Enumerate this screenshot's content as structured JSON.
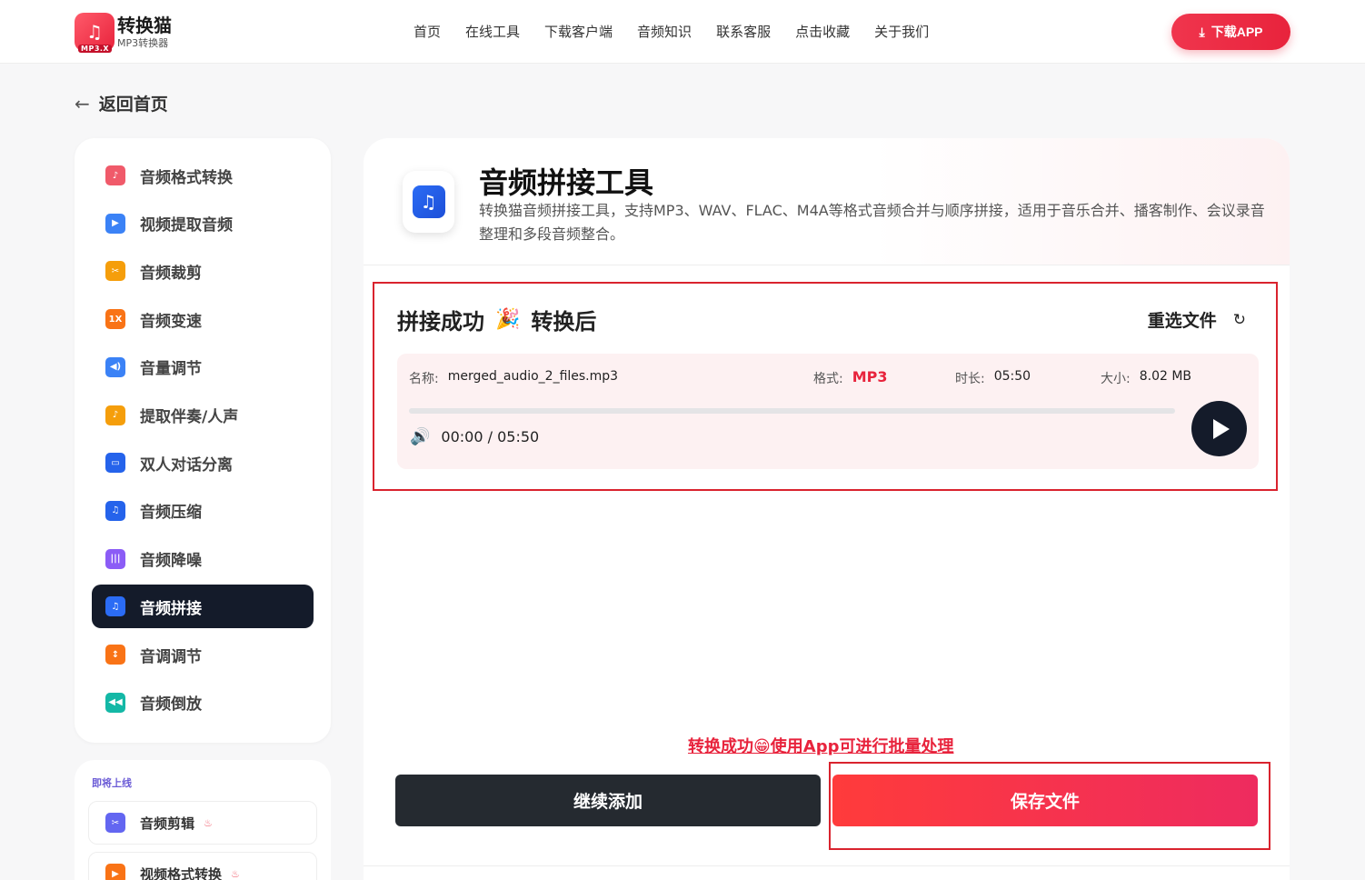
{
  "header": {
    "logo_title": "转换猫",
    "logo_sub": "MP3转换器",
    "logo_badge": "MP3.X",
    "nav": [
      "首页",
      "在线工具",
      "下载客户端",
      "音频知识",
      "联系客服",
      "点击收藏",
      "关于我们"
    ],
    "download_label": "下载APP"
  },
  "back_label": "返回首页",
  "sidebar": {
    "items": [
      {
        "label": "音频格式转换",
        "icon": "audio-format-icon",
        "color": "#f05a6a"
      },
      {
        "label": "视频提取音频",
        "icon": "video-extract-icon",
        "color": "#3b82f6"
      },
      {
        "label": "音频裁剪",
        "icon": "audio-cut-icon",
        "color": "#f59e0b"
      },
      {
        "label": "音频变速",
        "icon": "audio-speed-icon",
        "color": "#f97316",
        "text": "1X"
      },
      {
        "label": "音量调节",
        "icon": "volume-icon",
        "color": "#3b82f6"
      },
      {
        "label": "提取伴奏/人声",
        "icon": "vocal-extract-icon",
        "color": "#f59e0b"
      },
      {
        "label": "双人对话分离",
        "icon": "dialog-icon",
        "color": "#2563eb"
      },
      {
        "label": "音频压缩",
        "icon": "compress-icon",
        "color": "#2563eb"
      },
      {
        "label": "音频降噪",
        "icon": "denoise-icon",
        "color": "#8b5cf6"
      },
      {
        "label": "音频拼接",
        "icon": "merge-icon",
        "color": "#2b6cf5",
        "active": true
      },
      {
        "label": "音调调节",
        "icon": "pitch-icon",
        "color": "#f97316"
      },
      {
        "label": "音频倒放",
        "icon": "reverse-icon",
        "color": "#14b8a6"
      }
    ]
  },
  "upcoming": {
    "title": "即将上线",
    "items": [
      {
        "label": "音频剪辑",
        "icon": "scissors-icon",
        "color": "#6366f1"
      },
      {
        "label": "视频格式转换",
        "icon": "video-icon",
        "color": "#f97316"
      }
    ]
  },
  "tool": {
    "title": "音频拼接工具",
    "description": "转换猫音频拼接工具，支持MP3、WAV、FLAC、M4A等格式音频合并与顺序拼接，适用于音乐合并、播客制作、会议录音整理和多段音频整合。"
  },
  "result": {
    "title_left": "拼接成功",
    "party_emoji": "🎉",
    "title_right": "转换后",
    "reselect_label": "重选文件",
    "name_label": "名称:",
    "name_value": "merged_audio_2_files.mp3",
    "format_label": "格式:",
    "format_value": "MP3",
    "duration_label": "时长:",
    "duration_value": "05:50",
    "size_label": "大小:",
    "size_value": "8.02 MB",
    "time_display": "00:00 / 05:50",
    "progress": 0
  },
  "promo": "转换成功😁使用App可进行批量处理",
  "buttons": {
    "continue_label": "继续添加",
    "save_label": "保存文件"
  },
  "colors": {
    "accent": "#e8233c",
    "dark": "#141b2a"
  }
}
